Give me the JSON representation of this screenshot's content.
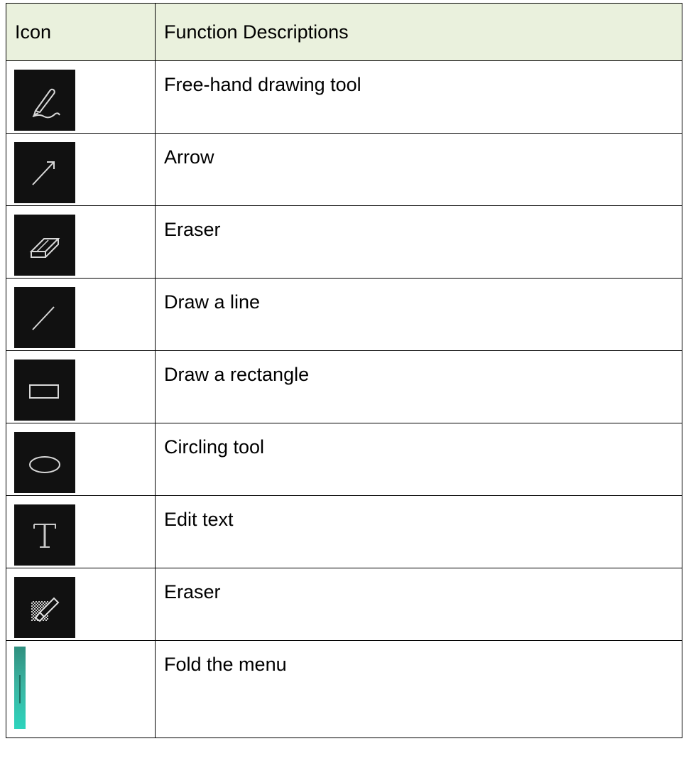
{
  "table": {
    "header": {
      "icon_col": "Icon",
      "desc_col": "Function Descriptions"
    },
    "rows": [
      {
        "icon": "freehand-pen-icon",
        "description": "Free-hand drawing tool"
      },
      {
        "icon": "arrow-icon",
        "description": "Arrow"
      },
      {
        "icon": "eraser-icon",
        "description": "Eraser"
      },
      {
        "icon": "line-icon",
        "description": "Draw a line"
      },
      {
        "icon": "rectangle-icon",
        "description": "Draw a rectangle"
      },
      {
        "icon": "ellipse-icon",
        "description": "Circling tool"
      },
      {
        "icon": "text-icon",
        "description": "Edit text"
      },
      {
        "icon": "clear-eraser-icon",
        "description": "Eraser"
      },
      {
        "icon": "fold-menu-bar-icon",
        "description": "Fold the menu"
      }
    ]
  },
  "colors": {
    "header_bg": "#eaf1dd",
    "icon_bg": "#111111",
    "fold_bar": "#2dd4bd"
  }
}
